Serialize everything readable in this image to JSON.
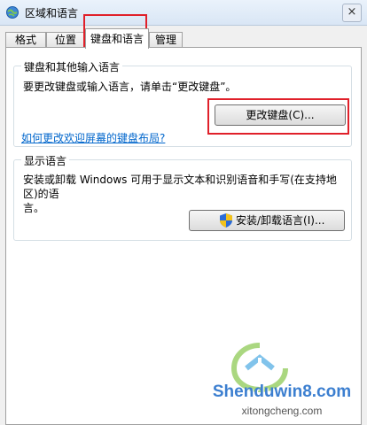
{
  "window": {
    "title": "区域和语言",
    "close_label": "×"
  },
  "tabs": [
    {
      "label": "格式"
    },
    {
      "label": "位置"
    },
    {
      "label": "键盘和语言"
    },
    {
      "label": "管理"
    }
  ],
  "keyboard_group": {
    "title": "键盘和其他输入语言",
    "description": "要更改键盘或输入语言，请单击“更改键盘”。",
    "change_keyboard_button": "更改键盘(C)...",
    "welcome_screen_link": "如何更改欢迎屏幕的键盘布局?"
  },
  "display_group": {
    "title": "显示语言",
    "description_line1": "安装或卸载 Windows 可用于显示文本和识别语音和手写(在支持地区)的语",
    "description_line2": "言。",
    "install_button": "安装/卸载语言(I)..."
  },
  "watermark": {
    "site": "Shenduwin8.com",
    "subsite": "xitongcheng.com"
  },
  "colors": {
    "highlight": "#e0202a",
    "link": "#0066cc",
    "shield_blue": "#2b6bd6",
    "shield_yellow": "#f2c21b"
  }
}
